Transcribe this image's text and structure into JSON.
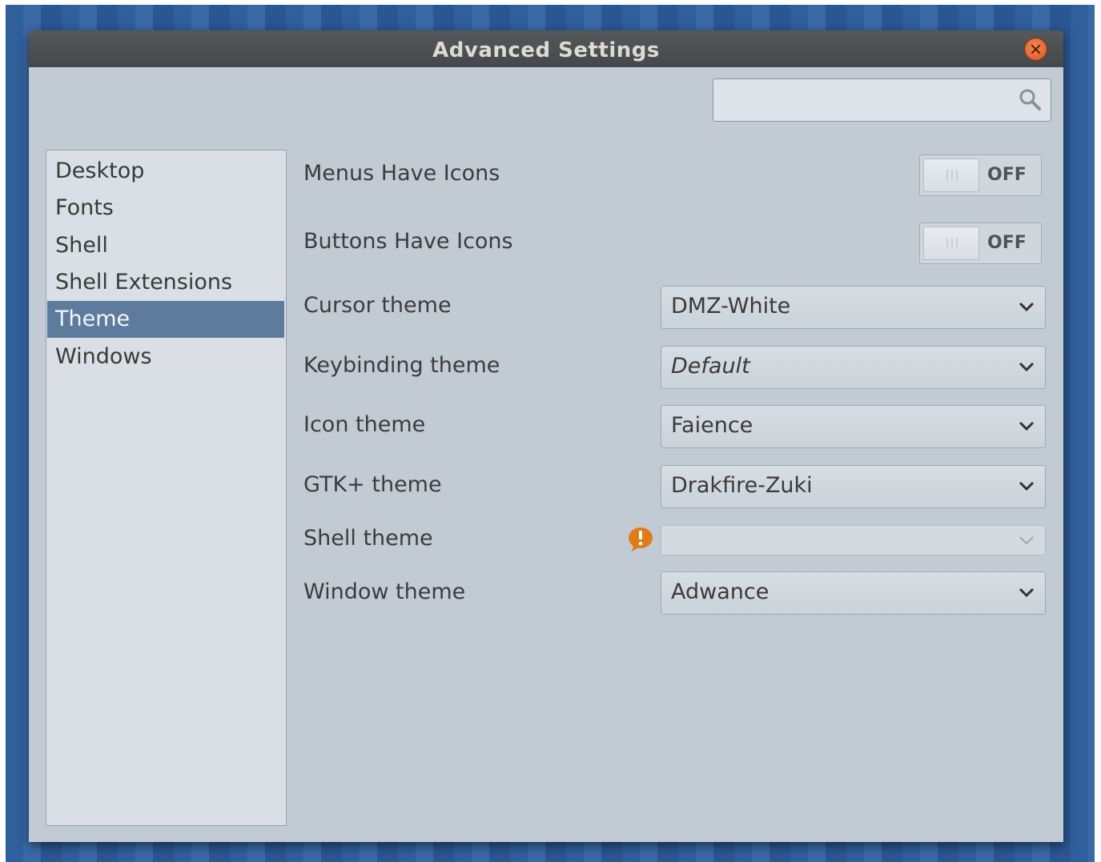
{
  "window": {
    "title": "Advanced Settings"
  },
  "search": {
    "value": "",
    "placeholder": ""
  },
  "sidebar": {
    "items": [
      {
        "label": "Desktop"
      },
      {
        "label": "Fonts"
      },
      {
        "label": "Shell"
      },
      {
        "label": "Shell Extensions"
      },
      {
        "label": "Theme",
        "selected": true
      },
      {
        "label": "Windows"
      }
    ]
  },
  "settings": {
    "menus_have_icons": {
      "label": "Menus Have Icons",
      "state": "OFF"
    },
    "buttons_have_icons": {
      "label": "Buttons Have Icons",
      "state": "OFF"
    },
    "cursor_theme": {
      "label": "Cursor theme",
      "value": "DMZ-White"
    },
    "keybinding_theme": {
      "label": "Keybinding theme",
      "value": "Default"
    },
    "icon_theme": {
      "label": "Icon theme",
      "value": "Faience"
    },
    "gtk_theme": {
      "label": "GTK+ theme",
      "value": "Drakfire-Zuki"
    },
    "shell_theme": {
      "label": "Shell theme",
      "value": "",
      "warning": true
    },
    "window_theme": {
      "label": "Window theme",
      "value": "Adwance"
    }
  },
  "colors": {
    "accent_selected": "#5d7b9c",
    "warning": "#e07b1a",
    "close_button": "#d9541f"
  }
}
